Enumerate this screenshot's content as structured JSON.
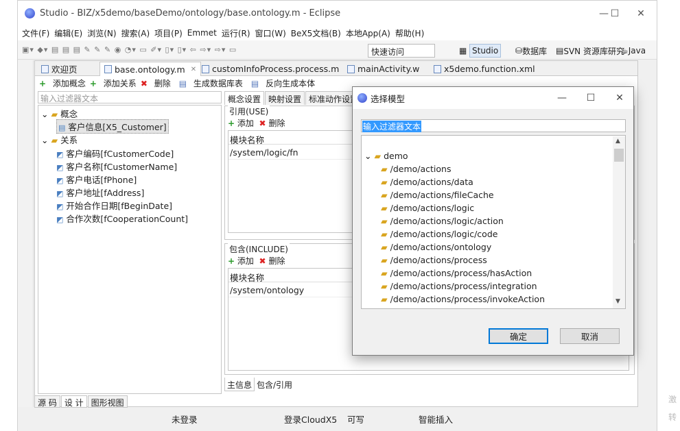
{
  "window": {
    "title": "Studio - BIZ/x5demo/baseDemo/ontology/base.ontology.m - Eclipse",
    "controls": [
      "—",
      "☐",
      "✕"
    ]
  },
  "menu": [
    "文件(F)",
    "编辑(E)",
    "浏览(N)",
    "搜索(A)",
    "项目(P)",
    "Emmet",
    "运行(R)",
    "窗口(W)",
    "BeX5文档(B)",
    "本地App(A)",
    "帮助(H)"
  ],
  "toolbar": {
    "quick_access": "快速访问",
    "perspectives": [
      "Studio",
      "数据库",
      "SVN 资源库研究",
      "Java"
    ]
  },
  "editor_tabs": [
    "欢迎页",
    "base.ontology.m",
    "customInfoProcess.process.m",
    "mainActivity.w",
    "x5demo.function.xml"
  ],
  "actions": {
    "add_concept": "添加概念",
    "add_relation": "添加关系",
    "delete": "删除",
    "gen_table": "生成数据库表",
    "reverse_gen": "反向生成本体"
  },
  "left": {
    "filter_placeholder": "输入过滤器文本",
    "concept_root": "概念",
    "concept_item": "客户信息[X5_Customer]",
    "relation_root": "关系",
    "relations": [
      "客户编码[fCustomerCode]",
      "客户名称[fCustomerName]",
      "客户电话[fPhone]",
      "客户地址[fAddress]",
      "开始合作日期[fBeginDate]",
      "合作次数[fCooperationCount]"
    ]
  },
  "right": {
    "tabs": [
      "概念设置",
      "映射设置",
      "标准动作设置"
    ],
    "use_group": {
      "label": "引用(USE)",
      "add": "添加",
      "delete": "删除",
      "header": "模块名称",
      "rows": [
        "/system/logic/fn"
      ]
    },
    "include_group": {
      "label": "包含(INCLUDE)",
      "add": "添加",
      "delete": "删除",
      "header": "模块名称",
      "rows": [
        "/system/ontology"
      ]
    },
    "bottom_tabs": [
      "主信息",
      "包含/引用"
    ]
  },
  "view_tabs": [
    "源 码",
    "设 计",
    "图形视图"
  ],
  "status": {
    "login": "未登录",
    "cloud": "登录CloudX5",
    "writable": "可写",
    "insert": "智能插入"
  },
  "dialog": {
    "title": "选择模型",
    "filter": "输入过滤器文本",
    "root": "demo",
    "items": [
      "/demo/actions",
      "/demo/actions/data",
      "/demo/actions/fileCache",
      "/demo/actions/logic",
      "/demo/actions/logic/action",
      "/demo/actions/logic/code",
      "/demo/actions/ontology",
      "/demo/actions/process",
      "/demo/actions/process/hasAction",
      "/demo/actions/process/integration",
      "/demo/actions/process/invokeAction"
    ],
    "ok": "确定",
    "cancel": "取消"
  },
  "watermark": [
    "激",
    "转"
  ]
}
